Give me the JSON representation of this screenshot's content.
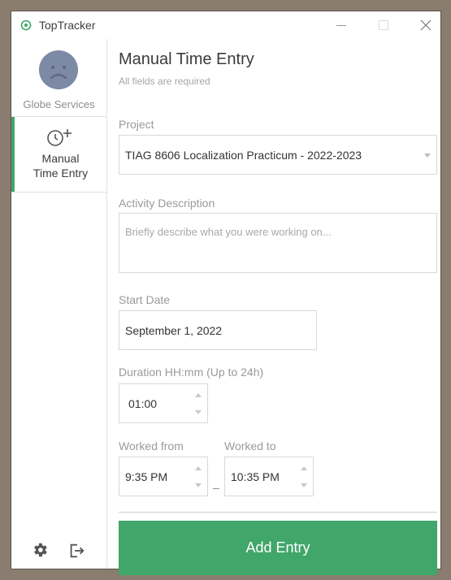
{
  "window": {
    "app_title": "TopTracker",
    "controls": {
      "minimize": "minimize-icon",
      "maximize": "maximize-icon",
      "close": "close-icon"
    }
  },
  "sidebar": {
    "org_name": "Globe Services",
    "nav": [
      {
        "label_line1": "Manual",
        "label_line2": "Time Entry",
        "icon": "clock-plus-icon",
        "active": true
      }
    ],
    "bottom_icons": [
      "gear-icon",
      "logout-icon"
    ]
  },
  "form": {
    "title": "Manual Time Entry",
    "subtitle": "All fields are required",
    "project": {
      "label": "Project",
      "value": "TIAG 8606 Localization Practicum - 2022-2023"
    },
    "activity": {
      "label": "Activity Description",
      "placeholder": "Briefly describe what you were working on..."
    },
    "start_date": {
      "label": "Start Date",
      "value": "September 1, 2022"
    },
    "duration": {
      "label": "Duration HH:mm (Up to 24h)",
      "value": "01:00"
    },
    "worked_from": {
      "label": "Worked from",
      "value": "9:35 PM"
    },
    "worked_to": {
      "label": "Worked to",
      "value": "10:35 PM"
    },
    "range_separator": "–",
    "submit_label": "Add Entry"
  },
  "colors": {
    "accent": "#40a66a",
    "background": "#8a7d6f",
    "label": "#9a9a9a"
  }
}
